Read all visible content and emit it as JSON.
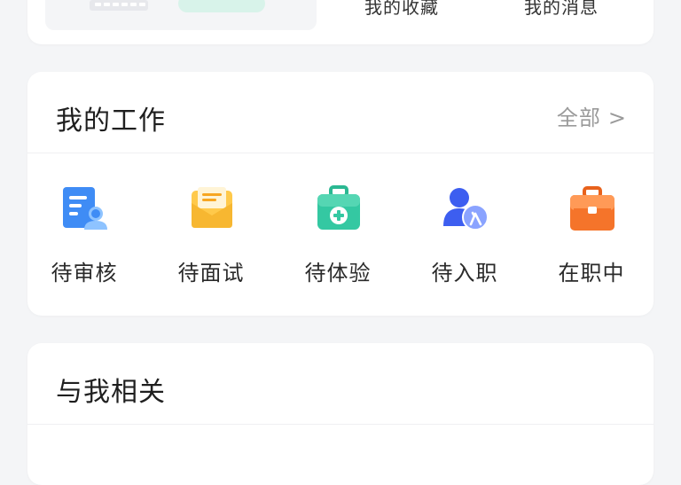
{
  "top_card": {
    "links": [
      "我的收藏",
      "我的消息"
    ]
  },
  "work_section": {
    "title": "我的工作",
    "more_label": "全部",
    "more_chevron": ">",
    "items": [
      {
        "label": "待审核",
        "icon": "review-document-icon",
        "color": "#3f8cf5"
      },
      {
        "label": "待面试",
        "icon": "interview-envelope-icon",
        "color": "#f7b731"
      },
      {
        "label": "待体验",
        "icon": "medical-kit-icon",
        "color": "#34c8a2"
      },
      {
        "label": "待入职",
        "icon": "user-onboard-icon",
        "color": "#4d6cf2"
      },
      {
        "label": "在职中",
        "icon": "briefcase-icon",
        "color": "#f5742a"
      }
    ]
  },
  "related_section": {
    "title": "与我相关"
  }
}
